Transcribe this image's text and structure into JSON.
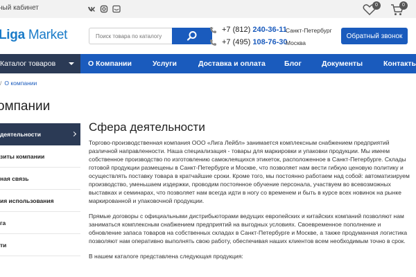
{
  "topbar": {
    "cabinet_label": "ный кабинет",
    "social_icons": [
      "vk-icon",
      "instagram-icon",
      "youtube-icon"
    ],
    "favorites_count": "0",
    "cart_count": "0"
  },
  "header": {
    "logo_part1": "Liga",
    "logo_part2": " Market",
    "search_placeholder": "Поиск товара по каталогу",
    "phones": [
      {
        "prefix": "+7 (812) ",
        "number": "240-36-11",
        "city": "Санкт-Петербург"
      },
      {
        "prefix": "+7 (495) ",
        "number": "108-76-30",
        "city": "Москва"
      }
    ],
    "callback_label": "Обратный звонок"
  },
  "nav": {
    "catalog_label": "Каталог товаров",
    "items": [
      "О Компании",
      "Услуги",
      "Доставка и оплата",
      "Блог",
      "Документы",
      "Контакты"
    ]
  },
  "breadcrumbs": {
    "sep": "/",
    "current": "О компании"
  },
  "page_title": "омпании",
  "sidebar": {
    "items": [
      {
        "label": " деятельности",
        "active": true
      },
      {
        "label": "зиты компании",
        "active": false
      },
      {
        "label": "ная связь",
        "active": false
      },
      {
        "label": "ия использования",
        "active": false
      },
      {
        "label": "га",
        "active": false
      },
      {
        "label": "ти",
        "active": false
      }
    ]
  },
  "content": {
    "heading": "Сфера деятельности",
    "paragraphs": [
      "Торгово-производственная компания ООО «Лига Лейбл» занимается комплексным снабжением предприятий различной направленности. Наша специализация - товары для маркировки и упаковки продукции. Мы имеем собственное производство по изготовлению самоклеящихся этикеток, расположенное в Санкт-Петербурге. Склады готовой продукции размещены в Санкт-Петербурге и Москве, что позволяет нам вести гибкую ценовую политику и осуществлять поставку товара в кратчайшие сроки. Кроме того, мы постоянно работаем над собой: автоматизируем производство, уменьшаем издержки, проводим постоянное обучение персонала, участвуем во всевозможных выставках и семинарах, что позволяет нам всегда идти в ногу со временем и быть в курсе всех новинок на рынке маркированной и упаковочной продукции.",
      "Прямые договоры с официальными дистрибьюторами ведущих европейских и китайских компаний позволяют нам заниматься комплексным снабжением предприятий на выгодных условиях. Своевременное пополнение и обновление запаса товаров на собственных складах в Санкт-Петербурге и Москве, а также продуманная логистика позволяют нам оперативно выполнять свою работу, обеспечивая наших клиентов всем необходимым точно в срок.",
      "В нашем каталоге представлена следующая продукция:"
    ]
  },
  "colors": {
    "brand_blue": "#1a5bbd",
    "dark_navy": "#2b3a55",
    "logo_blue": "#1a7bc8"
  }
}
